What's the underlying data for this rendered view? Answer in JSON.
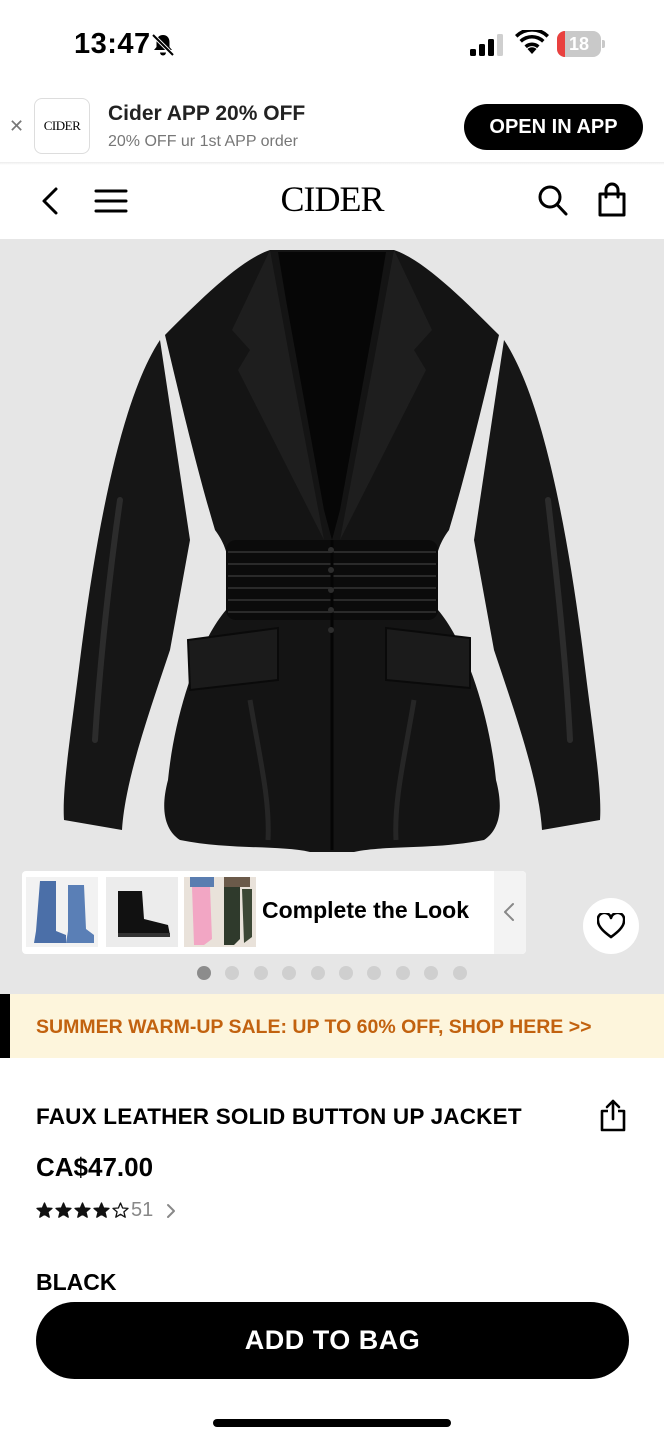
{
  "status_bar": {
    "time": "13:47",
    "battery": "18",
    "battery_level": 0.18,
    "icons": [
      "bell-slash-icon",
      "signal-icon",
      "wifi-icon",
      "battery-icon"
    ]
  },
  "app_banner": {
    "close_icon": "close-icon",
    "logo_text": "CIDER",
    "title": "Cider APP 20% OFF",
    "subtitle": "20% OFF ur 1st APP order",
    "button_label": "OPEN IN APP"
  },
  "nav": {
    "logo": "CIDER",
    "icons": [
      "chevron-left-icon",
      "menu-icon",
      "search-icon",
      "shopping-bag-icon"
    ]
  },
  "gallery": {
    "complete_the_look": "Complete the Look",
    "image_count": 10,
    "active_index": 0,
    "colors": {
      "background": "#e6e6e6",
      "jacket": "#121212"
    }
  },
  "promo": {
    "text": "SUMMER WARM-UP SALE: UP TO 60% OFF, SHOP HERE >>",
    "color": "#c2620f",
    "background": "#fdf5dc"
  },
  "product": {
    "title": "FAUX LEATHER SOLID BUTTON UP JACKET",
    "price": "CA$47.00",
    "rating": 4,
    "rating_max": 5,
    "review_count": "51",
    "color": "BLACK"
  },
  "actions": {
    "add_to_bag": "ADD TO BAG"
  }
}
